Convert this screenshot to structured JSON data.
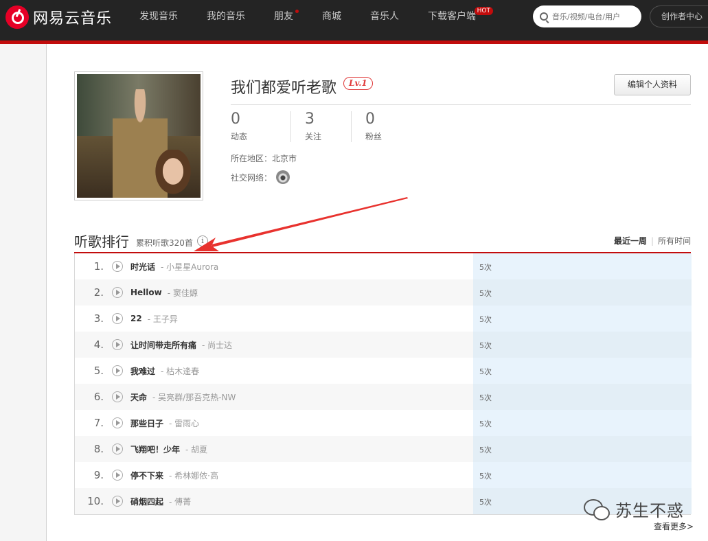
{
  "header": {
    "logo_text": "网易云音乐",
    "nav": [
      {
        "label": "发现音乐"
      },
      {
        "label": "我的音乐"
      },
      {
        "label": "朋友"
      },
      {
        "label": "商城"
      },
      {
        "label": "音乐人"
      },
      {
        "label": "下载客户端"
      }
    ],
    "hot_badge": "HOT",
    "search_placeholder": "音乐/视频/电台/用户",
    "creator_label": "创作者中心"
  },
  "profile": {
    "username": "我们都爱听老歌",
    "level": "Lv.1",
    "edit_label": "编辑个人资料",
    "stats": [
      {
        "num": "0",
        "label": "动态"
      },
      {
        "num": "3",
        "label": "关注"
      },
      {
        "num": "0",
        "label": "粉丝"
      }
    ],
    "location": "所在地区：北京市",
    "social_label": "社交网络："
  },
  "ranking": {
    "title": "听歌排行",
    "subtitle": "累积听歌320首",
    "info_icon": "i",
    "tab_week": "最近一周",
    "tab_sep": "|",
    "tab_all": "所有时间",
    "rows": [
      {
        "rank": "1.",
        "song": "时光话",
        "artist": "- 小星星Aurora",
        "count": "5次"
      },
      {
        "rank": "2.",
        "song": "Hellow",
        "artist": "- 窦佳嫄",
        "count": "5次"
      },
      {
        "rank": "3.",
        "song": "22",
        "artist": "- 王子异",
        "count": "5次"
      },
      {
        "rank": "4.",
        "song": "让时间带走所有痛",
        "artist": "- 尚士达",
        "count": "5次"
      },
      {
        "rank": "5.",
        "song": "我难过",
        "artist": "- 枯木逢春",
        "count": "5次"
      },
      {
        "rank": "6.",
        "song": "天命",
        "artist": "- 吴亮群/那吾克热-NW",
        "count": "5次"
      },
      {
        "rank": "7.",
        "song": "那些日子",
        "artist": "- 雷雨心",
        "count": "5次"
      },
      {
        "rank": "8.",
        "song": "飞翔吧！少年",
        "artist": "- 胡夏",
        "count": "5次"
      },
      {
        "rank": "9.",
        "song": "停不下来",
        "artist": "- 希林娜依·高",
        "count": "5次"
      },
      {
        "rank": "10.",
        "song": "硝烟四起",
        "artist": "- 傅菁",
        "count": "5次"
      }
    ],
    "more_label": "查看更多>"
  },
  "watermark": {
    "text": "苏生不惑"
  },
  "colors": {
    "brand_red": "#c20c0c",
    "topbar": "#242424",
    "play_bar": "#e8f3fc"
  }
}
